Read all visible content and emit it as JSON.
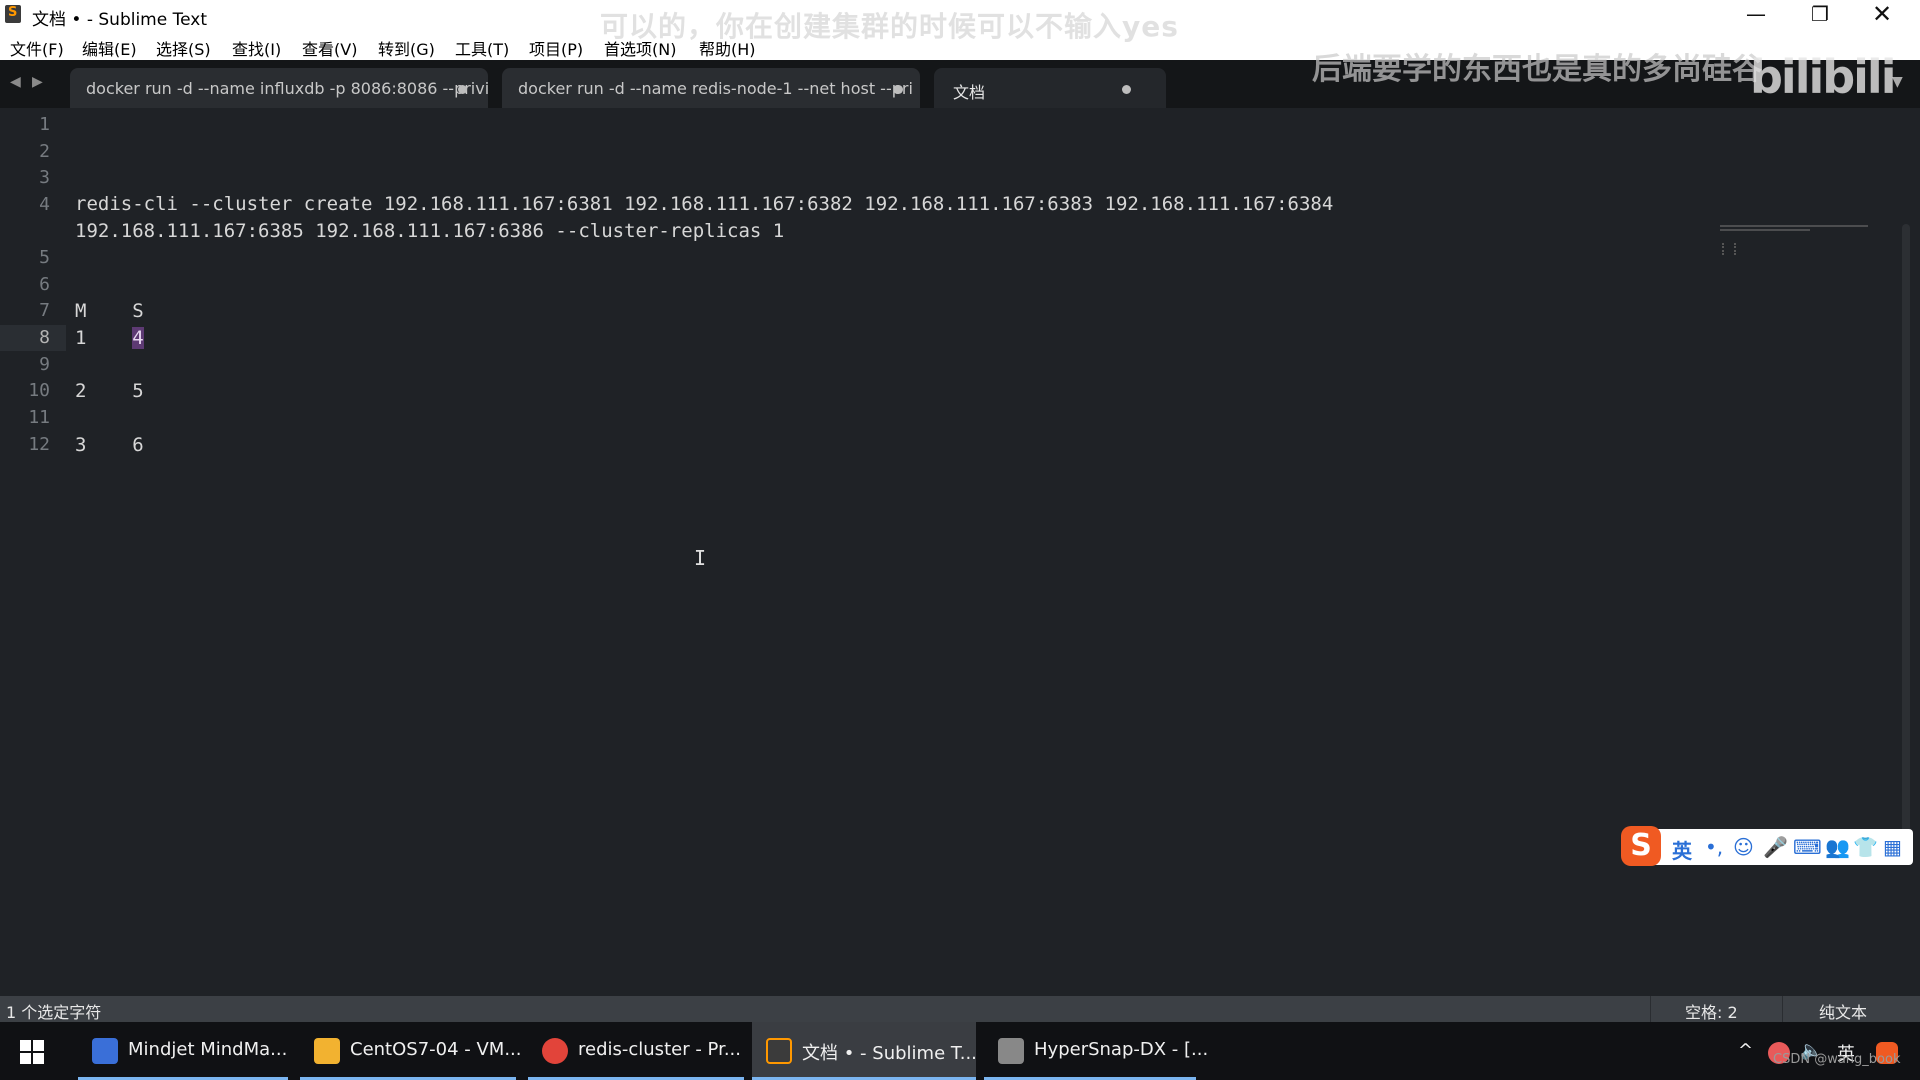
{
  "window": {
    "title": "文档 • - Sublime Text",
    "min": "—",
    "max": "❐",
    "close": "✕"
  },
  "menu": [
    "文件(F)",
    "编辑(E)",
    "选择(S)",
    "查找(I)",
    "查看(V)",
    "转到(G)",
    "工具(T)",
    "项目(P)",
    "首选项(N)",
    "帮助(H)"
  ],
  "overlay": {
    "subtitle": "可以的，你在创建集群的时候可以不输入yes",
    "watermark": "后端要学的东西也是真的多",
    "channel": "尚硅谷",
    "bili": "bilibili"
  },
  "tabs": [
    {
      "label": "docker run -d --name influxdb -p 8086:8086 --privi",
      "active": false
    },
    {
      "label": "docker run -d --name redis-node-1 --net host --pri",
      "active": false
    },
    {
      "label": "文档",
      "active": true
    }
  ],
  "tab_nav": {
    "prev": "◀",
    "next": "▶",
    "dropdown": "▼"
  },
  "editor": {
    "line_numbers": [
      "1",
      "2",
      "3",
      "4",
      "",
      "5",
      "6",
      "7",
      "8",
      "9",
      "10",
      "11",
      "12"
    ],
    "current_line": "8",
    "lines": {
      "l4a": "redis-cli --cluster create 192.168.111.167:6381 192.168.111.167:6382 192.168.111.167:6383 192.168.111.167:6384",
      "l4b": "192.168.111.167:6385 192.168.111.167:6386 --cluster-replicas 1",
      "l7": "M    S",
      "l8_prefix": "1    ",
      "l8_sel": "4",
      "l10": "2    5",
      "l12": "3    6"
    },
    "cursor": "I"
  },
  "ime": {
    "logo": "S",
    "lang": "英",
    "icons": [
      "punct-icon",
      "emoji-icon",
      "mic-icon",
      "keyboard-icon",
      "user-icon",
      "shirt-icon",
      "grid-icon"
    ],
    "glyphs": [
      "•,",
      "☺",
      "🎤",
      "⌨",
      "👥",
      "👕",
      "▦"
    ]
  },
  "status": {
    "selection": "1 个选定字符",
    "indent": "空格: 2",
    "syntax": "纯文本"
  },
  "taskbar": {
    "apps": [
      {
        "label": "Mindjet MindMa...",
        "color": "#3a6fd8"
      },
      {
        "label": "CentOS7-04 - VM...",
        "color": "#f2b230"
      },
      {
        "label": "redis-cluster - Pr...",
        "color": "#e2443a"
      },
      {
        "label": "文档 • - Sublime T...",
        "color": "#ff9800"
      },
      {
        "label": "HyperSnap-DX - [...",
        "color": "#888888"
      }
    ],
    "tray": {
      "chevron": "^",
      "volume": "🔈",
      "lang": "英"
    },
    "csdn": "CSDN @wang_book"
  }
}
